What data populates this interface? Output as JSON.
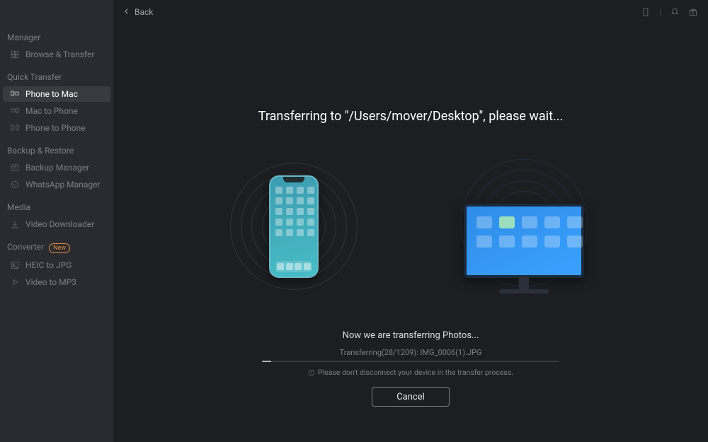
{
  "topbar": {
    "back_label": "Back"
  },
  "sidebar": {
    "sections": [
      {
        "title": "Manager",
        "items": [
          {
            "label": "Browse & Transfer",
            "icon": "browse"
          }
        ]
      },
      {
        "title": "Quick Transfer",
        "items": [
          {
            "label": "Phone to Mac",
            "icon": "phone-to-mac",
            "active": true
          },
          {
            "label": "Mac to Phone",
            "icon": "mac-to-phone"
          },
          {
            "label": "Phone to Phone",
            "icon": "phone-to-phone"
          }
        ]
      },
      {
        "title": "Backup & Restore",
        "items": [
          {
            "label": "Backup Manager",
            "icon": "backup"
          },
          {
            "label": "WhatsApp Manager",
            "icon": "whatsapp"
          }
        ]
      },
      {
        "title": "Media",
        "items": [
          {
            "label": "Video Downloader",
            "icon": "download"
          }
        ]
      },
      {
        "title": "Converter",
        "badge": "New",
        "items": [
          {
            "label": "HEIC to JPG",
            "icon": "heic"
          },
          {
            "label": "Video to MP3",
            "icon": "video-mp3"
          }
        ]
      }
    ]
  },
  "transfer": {
    "headline": "Transferring to \"/Users/mover/Desktop\", please wait...",
    "status_category": "Now we are transferring Photos...",
    "status_detail": "Transferring(28/1209): IMG_0006(1).JPG",
    "warning": "Please don't disconnect your device in the transfer process.",
    "cancel_label": "Cancel",
    "progress_percent": 3
  }
}
